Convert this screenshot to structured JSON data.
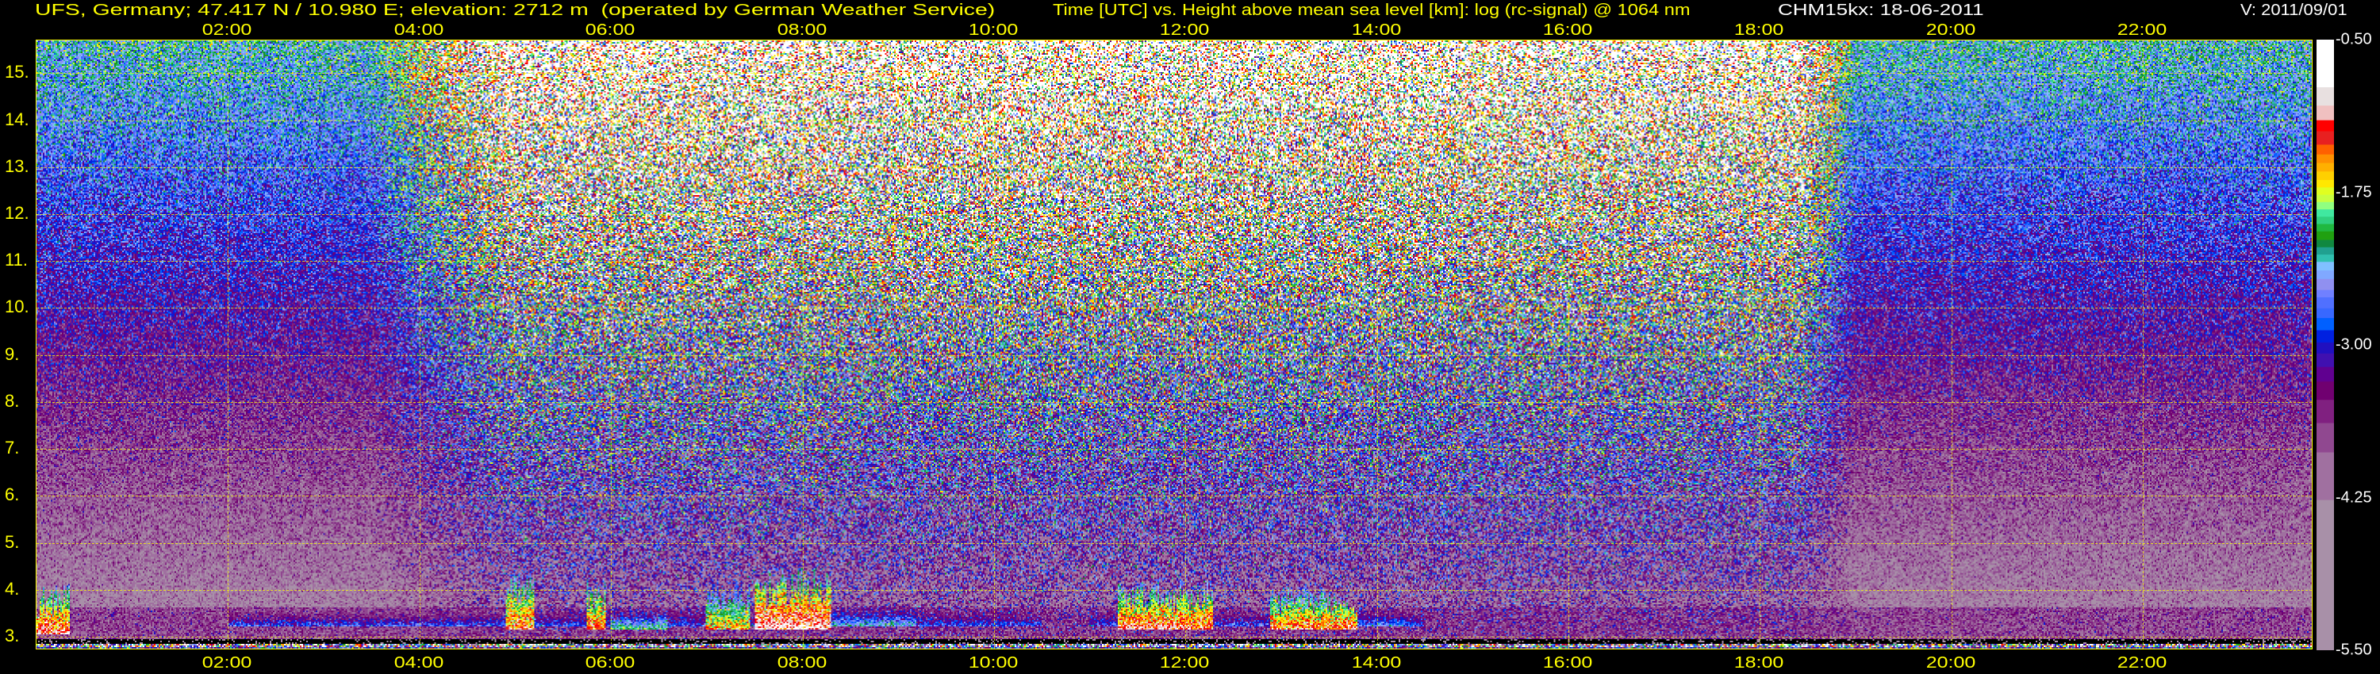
{
  "header": {
    "station": "UFS, Germany; 47.417 N / 10.980 E; elevation: 2712 m  (operated by German Weather Service)",
    "axis_title": "Time [UTC] vs. Height above mean sea level [km]: log (rc-signal) @ 1064 nm",
    "instrument": "CHM15kx: 18-06-2011",
    "version": "V: 2011/09/01"
  },
  "colors": {
    "text_primary": "#ffff00",
    "text_secondary": "#ffffff",
    "grid": "#ffff00",
    "background": "#000000"
  },
  "chart_data": {
    "type": "heatmap",
    "title": "Time [UTC] vs. Height above mean sea level [km]: log (rc-signal) @ 1064 nm",
    "xlabel": "Time [UTC]",
    "ylabel": "Height above mean sea level [km]",
    "xlim": [
      0,
      23.78
    ],
    "ylim": [
      2.712,
      15.7
    ],
    "grid": true,
    "x_ticks": [
      {
        "value": 2,
        "label": "02:00"
      },
      {
        "value": 4,
        "label": "04:00"
      },
      {
        "value": 6,
        "label": "06:00"
      },
      {
        "value": 8,
        "label": "08:00"
      },
      {
        "value": 10,
        "label": "10:00"
      },
      {
        "value": 12,
        "label": "12:00"
      },
      {
        "value": 14,
        "label": "14:00"
      },
      {
        "value": 16,
        "label": "16:00"
      },
      {
        "value": 18,
        "label": "18:00"
      },
      {
        "value": 20,
        "label": "20:00"
      },
      {
        "value": 22,
        "label": "22:00"
      }
    ],
    "y_ticks": [
      {
        "value": 3,
        "label": "3."
      },
      {
        "value": 4,
        "label": "4."
      },
      {
        "value": 5,
        "label": "5."
      },
      {
        "value": 6,
        "label": "6."
      },
      {
        "value": 7,
        "label": "7."
      },
      {
        "value": 8,
        "label": "8."
      },
      {
        "value": 9,
        "label": "9."
      },
      {
        "value": 10,
        "label": "10."
      },
      {
        "value": 11,
        "label": "11."
      },
      {
        "value": 12,
        "label": "12."
      },
      {
        "value": 13,
        "label": "13."
      },
      {
        "value": 14,
        "label": "14."
      },
      {
        "value": 15,
        "label": "15."
      }
    ],
    "colorbar": {
      "range": [
        -5.5,
        -0.5
      ],
      "ticks": [
        {
          "value": -0.5,
          "label": "-0.50"
        },
        {
          "value": -1.75,
          "label": "-1.75"
        },
        {
          "value": -3.0,
          "label": "-3.00"
        },
        {
          "value": -4.25,
          "label": "-4.25"
        },
        {
          "value": -5.5,
          "label": "-5.50"
        }
      ],
      "levels": [
        {
          "min": -0.89,
          "color": "#ffffff"
        },
        {
          "min": -1.04,
          "color": "#e8e0e0"
        },
        {
          "min": -1.16,
          "color": "#f0c0c0"
        },
        {
          "min": -1.25,
          "color": "#ff0000"
        },
        {
          "min": -1.36,
          "color": "#e82020"
        },
        {
          "min": -1.44,
          "color": "#ff6000"
        },
        {
          "min": -1.51,
          "color": "#ff9000"
        },
        {
          "min": -1.58,
          "color": "#ffb000"
        },
        {
          "min": -1.65,
          "color": "#ffd000"
        },
        {
          "min": -1.71,
          "color": "#ffe800"
        },
        {
          "min": -1.77,
          "color": "#e0ff20"
        },
        {
          "min": -1.83,
          "color": "#c8ff40"
        },
        {
          "min": -1.89,
          "color": "#90ff80"
        },
        {
          "min": -1.95,
          "color": "#40e8a0"
        },
        {
          "min": -2.01,
          "color": "#30d080"
        },
        {
          "min": -2.07,
          "color": "#20b840"
        },
        {
          "min": -2.14,
          "color": "#20a010"
        },
        {
          "min": -2.2,
          "color": "#108840"
        },
        {
          "min": -2.26,
          "color": "#20a090"
        },
        {
          "min": -2.32,
          "color": "#30c0b0"
        },
        {
          "min": -2.39,
          "color": "#80c0ff"
        },
        {
          "min": -2.46,
          "color": "#80a8ff"
        },
        {
          "min": -2.55,
          "color": "#9090f0"
        },
        {
          "min": -2.61,
          "color": "#7080ff"
        },
        {
          "min": -2.7,
          "color": "#5070ff"
        },
        {
          "min": -2.78,
          "color": "#3868ff"
        },
        {
          "min": -2.88,
          "color": "#0060ff"
        },
        {
          "min": -2.98,
          "color": "#0020e0"
        },
        {
          "min": -3.07,
          "color": "#2010c0"
        },
        {
          "min": -3.18,
          "color": "#4010b0"
        },
        {
          "min": -3.3,
          "color": "#600090"
        },
        {
          "min": -3.45,
          "color": "#700070"
        },
        {
          "min": -3.64,
          "color": "#802080"
        },
        {
          "min": -3.88,
          "color": "#904890"
        },
        {
          "min": -4.27,
          "color": "#a070a0"
        },
        {
          "min": -5.5,
          "color": "#a890a8"
        }
      ]
    },
    "features": [
      {
        "kind": "aerosol-cloud",
        "t": [
          0.0,
          0.35
        ],
        "h": [
          3.0,
          4.1
        ],
        "peak": -1.0
      },
      {
        "kind": "aerosol-cloud",
        "t": [
          4.9,
          5.2
        ],
        "h": [
          3.1,
          4.5
        ],
        "peak": -1.2
      },
      {
        "kind": "aerosol-cloud",
        "t": [
          5.75,
          5.95
        ],
        "h": [
          3.1,
          4.3
        ],
        "peak": -1.2
      },
      {
        "kind": "aerosol-cloud",
        "t": [
          6.0,
          6.6
        ],
        "h": [
          3.1,
          3.6
        ],
        "peak": -2.0
      },
      {
        "kind": "aerosol-cloud",
        "t": [
          7.0,
          7.45
        ],
        "h": [
          3.1,
          4.2
        ],
        "peak": -1.5
      },
      {
        "kind": "aerosol-cloud",
        "t": [
          7.5,
          8.3
        ],
        "h": [
          3.1,
          4.45
        ],
        "peak": -0.9
      },
      {
        "kind": "aerosol-cloud",
        "t": [
          8.3,
          9.2
        ],
        "h": [
          3.2,
          3.7
        ],
        "peak": -2.4
      },
      {
        "kind": "aerosol-cloud",
        "t": [
          11.3,
          12.3
        ],
        "h": [
          3.1,
          4.2
        ],
        "peak": -1.1
      },
      {
        "kind": "aerosol-cloud",
        "t": [
          12.9,
          13.8
        ],
        "h": [
          3.1,
          4.05
        ],
        "peak": -1.2
      },
      {
        "kind": "aerosol-cloud",
        "t": [
          13.8,
          14.3
        ],
        "h": [
          3.2,
          3.6
        ],
        "peak": -2.6
      },
      {
        "kind": "haze-layer",
        "t": [
          2.0,
          10.5
        ],
        "h": [
          3.2,
          3.6
        ],
        "peak": -2.8
      },
      {
        "kind": "haze-layer",
        "t": [
          11.0,
          14.5
        ],
        "h": [
          3.2,
          3.6
        ],
        "peak": -2.8
      }
    ]
  }
}
